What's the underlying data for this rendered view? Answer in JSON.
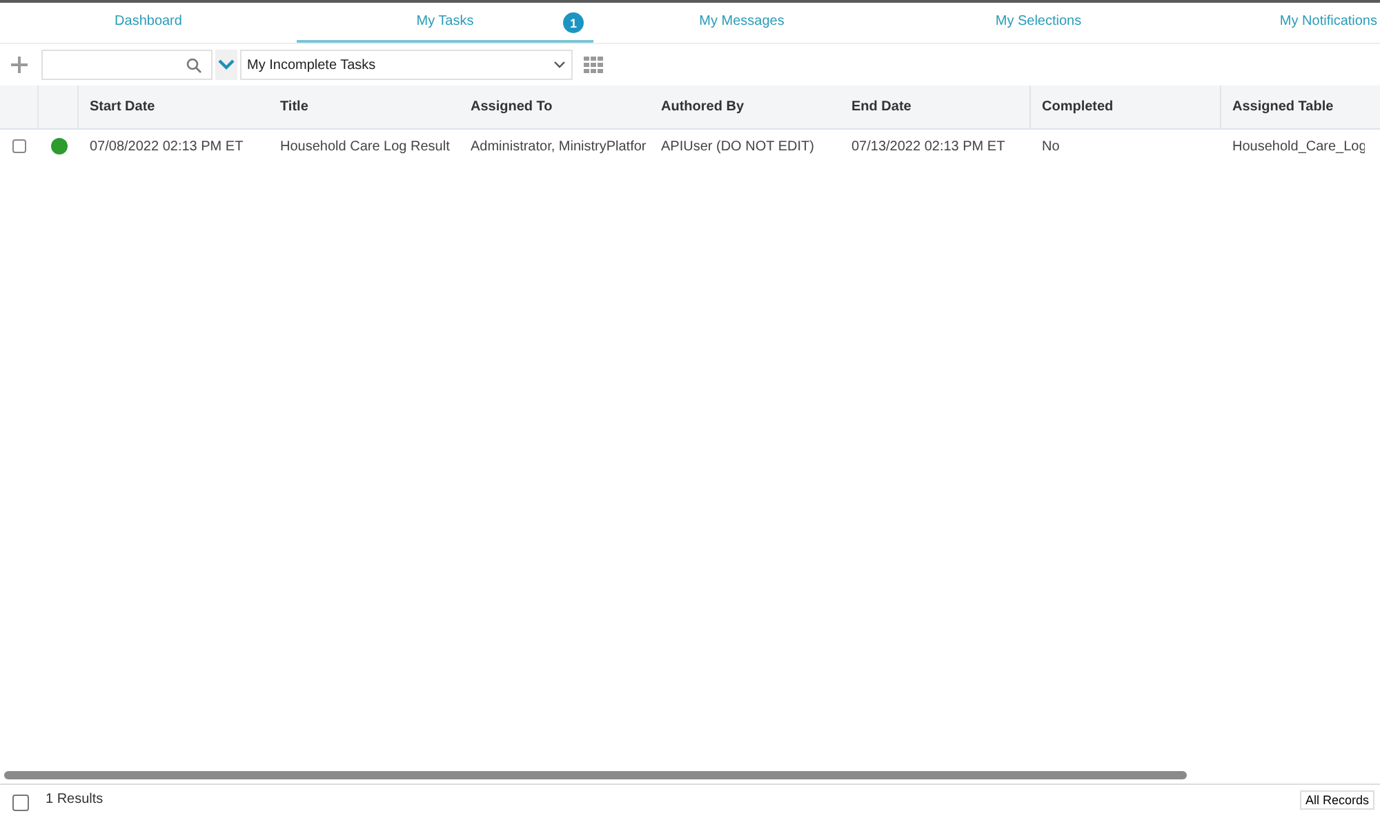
{
  "tabs": [
    {
      "label": "Dashboard",
      "selected": false
    },
    {
      "label": "My Tasks",
      "selected": true,
      "badge": "1"
    },
    {
      "label": "My Messages",
      "selected": false
    },
    {
      "label": "My Selections",
      "selected": false
    },
    {
      "label": "My Notifications",
      "selected": false
    }
  ],
  "toolbar": {
    "view": "My Incomplete Tasks"
  },
  "table": {
    "columns": [
      "Start Date",
      "Title",
      "Assigned To",
      "Authored By",
      "End Date",
      "Completed",
      "Assigned Table"
    ],
    "rows": [
      {
        "checked": false,
        "color": "#2e9b2e",
        "cells": [
          "07/08/2022 02:13 PM ET",
          "Household Care Log Result",
          "Administrator, MinistryPlatfor",
          "APIUser (DO NOT EDIT)",
          "07/13/2022 02:13 PM ET",
          "No",
          "Household_Care_Log"
        ]
      }
    ]
  },
  "footer": {
    "checked": false,
    "results": "1 Results",
    "records": "All Records"
  }
}
